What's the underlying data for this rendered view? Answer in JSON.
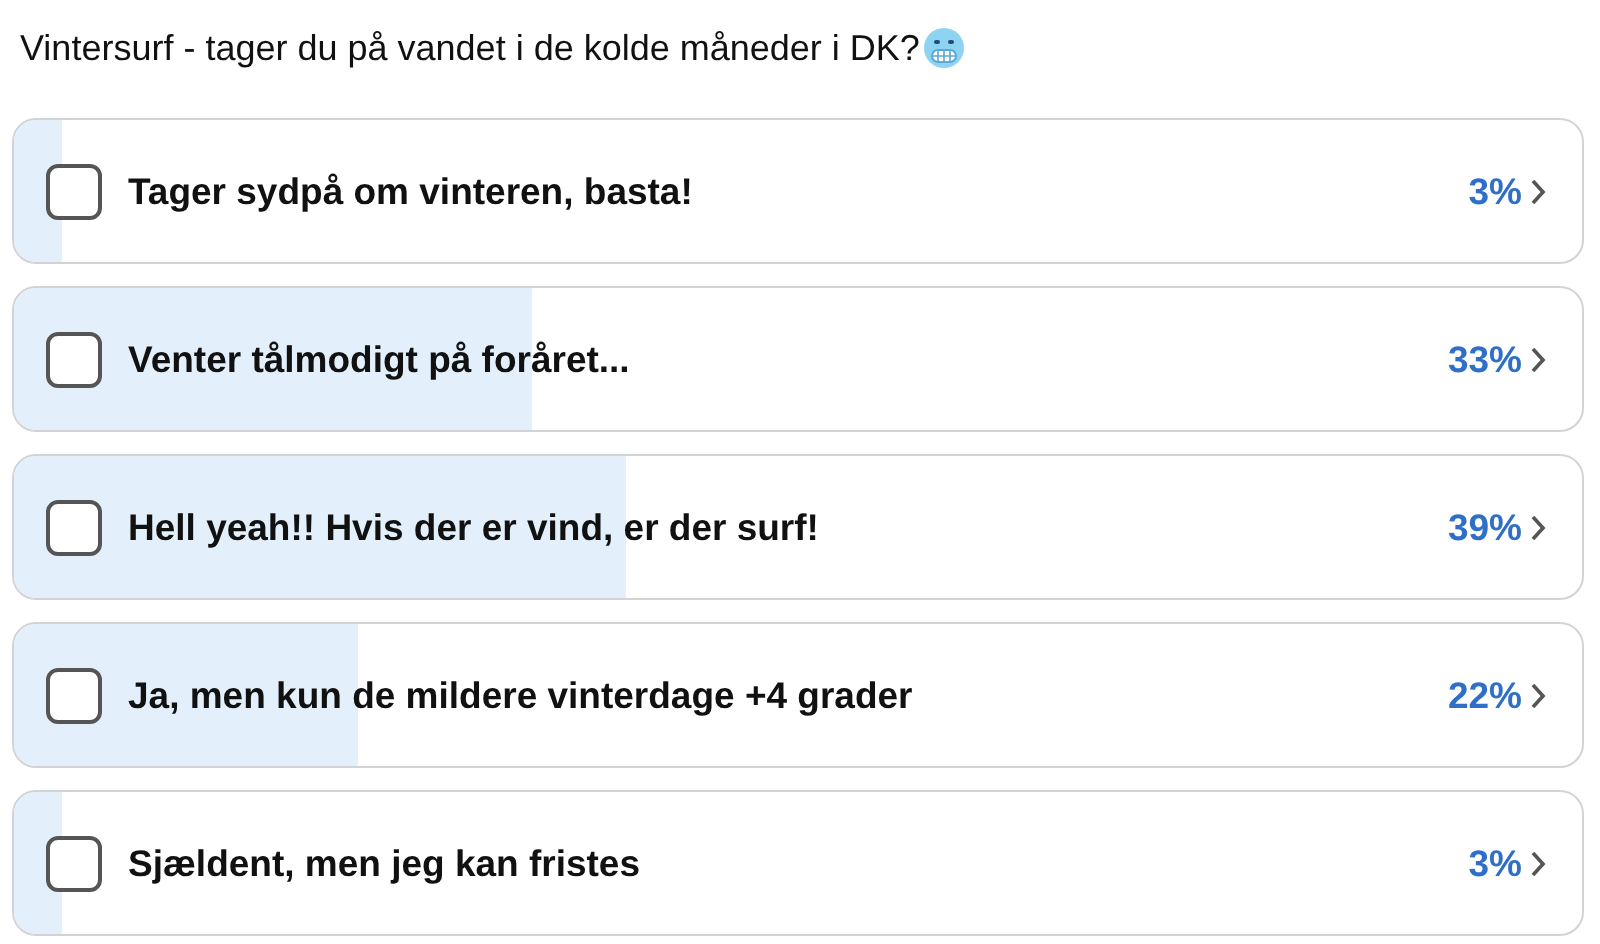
{
  "question": "Vintersurf - tager du på vandet i de kolde måneder i DK?",
  "options": [
    {
      "label": "Tager sydpå om vinteren, basta!",
      "checked": false,
      "level": 0.03,
      "percent": "3%"
    },
    {
      "label": "Venter tålmodigt på foråret...",
      "checked": false,
      "level": 0.33,
      "percent": "33%"
    },
    {
      "label": "Hell yeah!! Hvis der er vind, er der surf!",
      "checked": false,
      "level": 0.39,
      "percent": "39%"
    },
    {
      "label": "Ja, men kun de mildere vinterdage +4 grader",
      "checked": false,
      "level": 0.22,
      "percent": "22%"
    },
    {
      "label": "Sjældent, men jeg kan fristes",
      "checked": false,
      "level": 0.03,
      "percent": "3%"
    }
  ]
}
